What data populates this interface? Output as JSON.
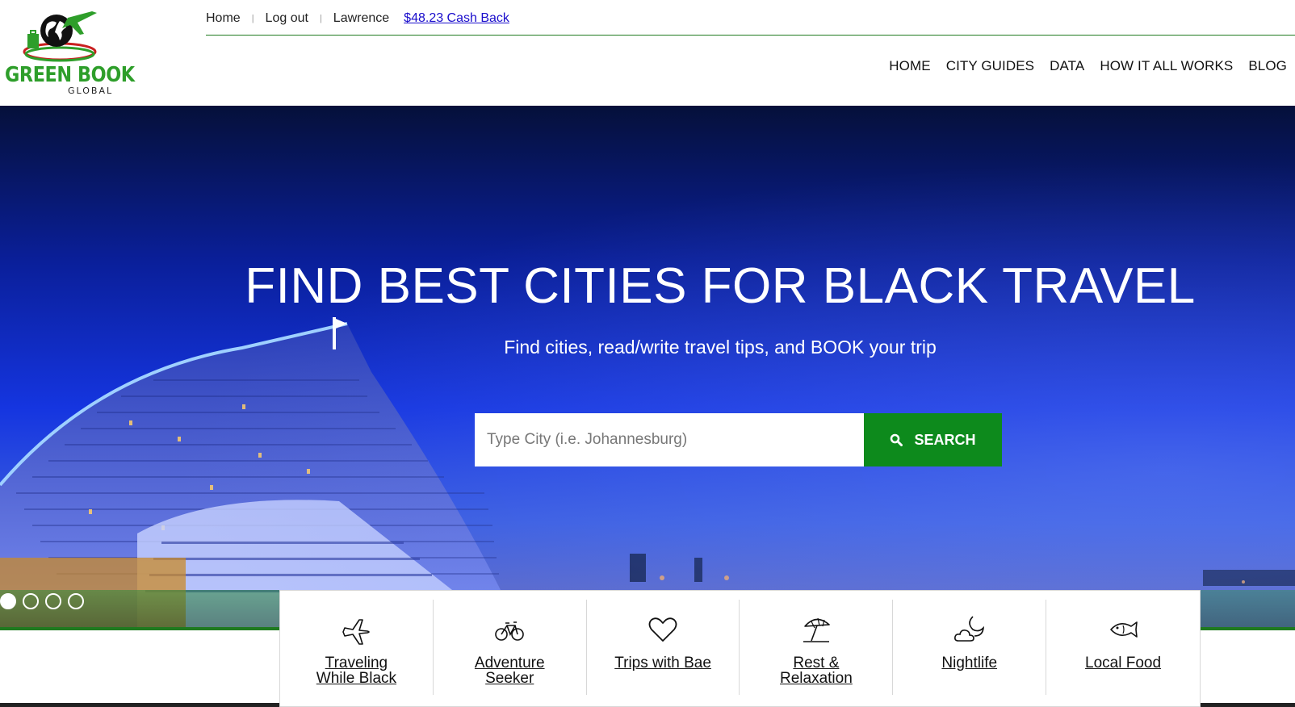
{
  "brand": {
    "name_line1": "GREEN BOOK",
    "name_line2": "GLOBAL"
  },
  "topbar": {
    "home": "Home",
    "logout": "Log out",
    "user": "Lawrence",
    "cashback": "$48.23 Cash Back"
  },
  "nav": [
    "HOME",
    "CITY GUIDES",
    "DATA",
    "HOW IT ALL WORKS",
    "BLOG"
  ],
  "hero": {
    "title": "FIND BEST CITIES FOR BLACK TRAVEL",
    "subtitle": "Find cities, read/write travel tips, and BOOK your trip",
    "search_placeholder": "Type City (i.e. Johannesburg)",
    "search_button": "SEARCH",
    "slide_count": 4,
    "active_slide": 1
  },
  "categories": [
    {
      "label": "Traveling While Black",
      "icon": "airplane-icon"
    },
    {
      "label": "Adventure Seeker",
      "icon": "bicycle-icon"
    },
    {
      "label": "Trips with Bae",
      "icon": "heart-icon"
    },
    {
      "label": "Rest & Relaxation",
      "icon": "beach-umbrella-icon"
    },
    {
      "label": "Nightlife",
      "icon": "moon-cloud-icon"
    },
    {
      "label": "Local Food",
      "icon": "fish-icon"
    }
  ],
  "colors": {
    "brand_green": "#0d8a1c",
    "link_blue": "#1a0dcc",
    "hero_blue": "#1535e0"
  }
}
